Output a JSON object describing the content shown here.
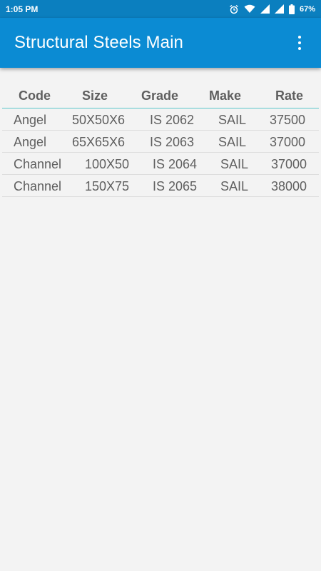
{
  "status_bar": {
    "time": "1:05 PM",
    "battery": "67%",
    "icons": [
      "alarm-icon",
      "wifi-icon",
      "signal-icon",
      "signal-icon",
      "battery-icon"
    ]
  },
  "app_bar": {
    "title": "Structural Steels Main",
    "menu_icon": "more-vert-icon"
  },
  "table": {
    "headers": [
      "Code",
      "Size",
      "Grade",
      "Make",
      "Rate"
    ],
    "rows": [
      [
        "Angel",
        "50X50X6",
        "IS 2062",
        "SAIL",
        "37500"
      ],
      [
        "Angel",
        "65X65X6",
        "IS 2063",
        "SAIL",
        "37000"
      ],
      [
        "Channel",
        "100X50",
        "IS 2064",
        "SAIL",
        "37000"
      ],
      [
        "Channel",
        "150X75",
        "IS 2065",
        "SAIL",
        "38000"
      ]
    ]
  },
  "colors": {
    "status_bar": "#0b7fbf",
    "app_bar": "#0b8bd3",
    "header_divider": "#5bc6c9",
    "text": "#5f5f5f",
    "background": "#f3f3f3"
  }
}
